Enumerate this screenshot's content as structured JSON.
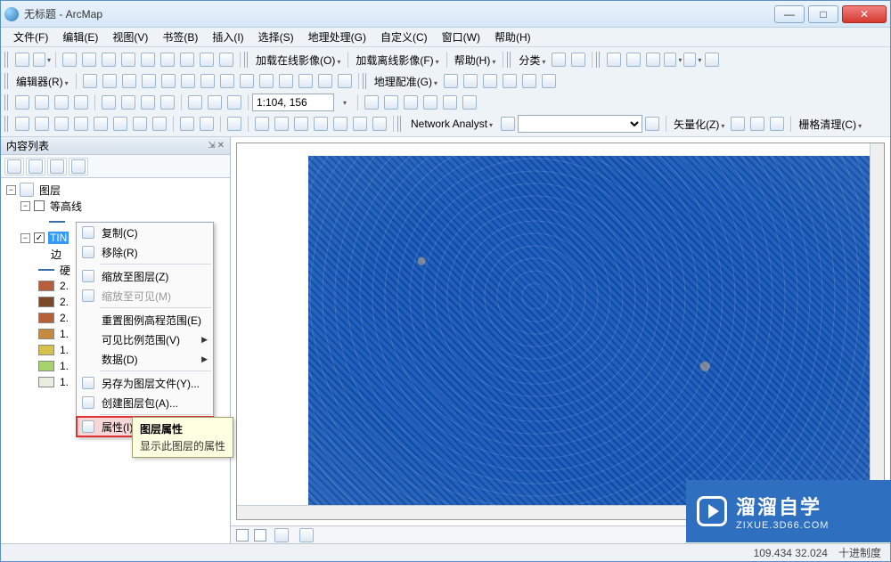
{
  "window": {
    "title": "无标题 - ArcMap"
  },
  "menu": {
    "items": [
      "文件(F)",
      "编辑(E)",
      "视图(V)",
      "书签(B)",
      "插入(I)",
      "选择(S)",
      "地理处理(G)",
      "自定义(C)",
      "窗口(W)",
      "帮助(H)"
    ]
  },
  "toolbar_labels": {
    "load_online": "加载在线影像(O)",
    "load_offline": "加载离线影像(F)",
    "help": "帮助(H)",
    "classify": "分类",
    "editor": "编辑器(R)",
    "georef": "地理配准(G)",
    "vectorize": "矢量化(Z)",
    "raster_clean": "栅格清理(C)",
    "network_analyst": "Network Analyst"
  },
  "scale": "1:104, 156",
  "toc": {
    "title": "内容列表",
    "root": "图层",
    "contour": "等高线",
    "tin": "TIN",
    "legend_part1": "边",
    "legend_part2": "硬",
    "classes": [
      "2.",
      "2.",
      "2.",
      "1.",
      "1.",
      "1.",
      "1."
    ],
    "class_colors": [
      "#b75f3a",
      "#7a4a2a",
      "#b75f3a",
      "#c48a3e",
      "#d6c24a",
      "#a6d46a",
      "#e8efe0"
    ]
  },
  "context_menu": {
    "items": [
      {
        "label": "复制(C)",
        "icon": "copy-icon"
      },
      {
        "label": "移除(R)",
        "icon": "remove-icon"
      },
      {
        "label": "缩放至图层(Z)",
        "icon": "zoom-layer-icon"
      },
      {
        "label": "缩放至可见(M)",
        "icon": "zoom-visible-icon",
        "disabled": true
      },
      {
        "label": "重置图例高程范围(E)"
      },
      {
        "label": "可见比例范围(V)",
        "submenu": true
      },
      {
        "label": "数据(D)",
        "submenu": true
      },
      {
        "label": "另存为图层文件(Y)...",
        "icon": "save-layer-icon"
      },
      {
        "label": "创建图层包(A)...",
        "icon": "layer-package-icon"
      },
      {
        "label": "属性(I)...",
        "icon": "properties-icon",
        "highlight": true
      }
    ]
  },
  "tooltip": {
    "title": "图层属性",
    "body": "显示此图层的属性"
  },
  "status": {
    "coords": "109.434  32.024",
    "unit": "十进制度"
  },
  "watermark": {
    "big": "溜溜自学",
    "small": "ZIXUE.3D66.COM"
  }
}
